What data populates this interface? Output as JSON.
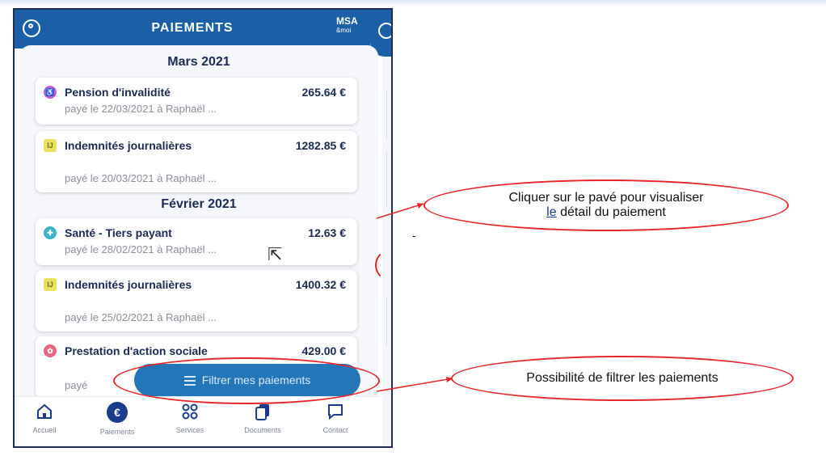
{
  "header": {
    "title": "PAIEMENTS",
    "brand": "MSA",
    "brand_sub": "&moi"
  },
  "months": [
    {
      "label": "Mars 2021"
    },
    {
      "label": "Février 2021"
    }
  ],
  "payments": [
    {
      "label": "Pension d'invalidité",
      "amount": "265.64 €",
      "detail": "payé le 22/03/2021 à Raphaël ...",
      "icon": "wheelchair-icon",
      "icon_color": "#c65bd3"
    },
    {
      "label": "Indemnités journalières",
      "amount": "1282.85 €",
      "detail": "payé le 20/03/2021 à Raphaël ...",
      "icon": "ij-icon",
      "icon_color": "#e9e25a"
    },
    {
      "label": "Santé - Tiers payant",
      "amount": "12.63 €",
      "detail": "payé le 28/02/2021 à Raphaël ...",
      "icon": "stethoscope-icon",
      "icon_color": "#3bb3c8"
    },
    {
      "label": "Indemnités journalières",
      "amount": "1400.32 €",
      "detail": "payé le 25/02/2021 à Raphaël ...",
      "icon": "ij-icon",
      "icon_color": "#e9e25a"
    },
    {
      "label": "Prestation d'action sociale",
      "amount": "429.00 €",
      "detail": "payé",
      "icon": "handshake-icon",
      "icon_color": "#e8667f"
    }
  ],
  "filter_button": {
    "label": "Filtrer mes paiements"
  },
  "tabs": [
    {
      "label": "Accueil",
      "icon": "home-icon"
    },
    {
      "label": "Paiements",
      "icon": "euro-icon",
      "active": true
    },
    {
      "label": "Services",
      "icon": "grid-icon"
    },
    {
      "label": "Documents",
      "icon": "documents-icon"
    },
    {
      "label": "Contact",
      "icon": "chat-icon"
    }
  ],
  "annotations": {
    "card_hint": "Cliquer sur le pavé pour visualiser le détail du paiement",
    "card_hint_line1": "Cliquer sur le pavé pour visualiser",
    "card_hint_line2_underlined": "le",
    "card_hint_line2_rest": "détail du paiement",
    "filter_hint": "Possibilité de filtrer les paiements"
  },
  "colors": {
    "header": "#1b5fa6",
    "accent": "#2377b9",
    "annotation": "#e5262b"
  }
}
